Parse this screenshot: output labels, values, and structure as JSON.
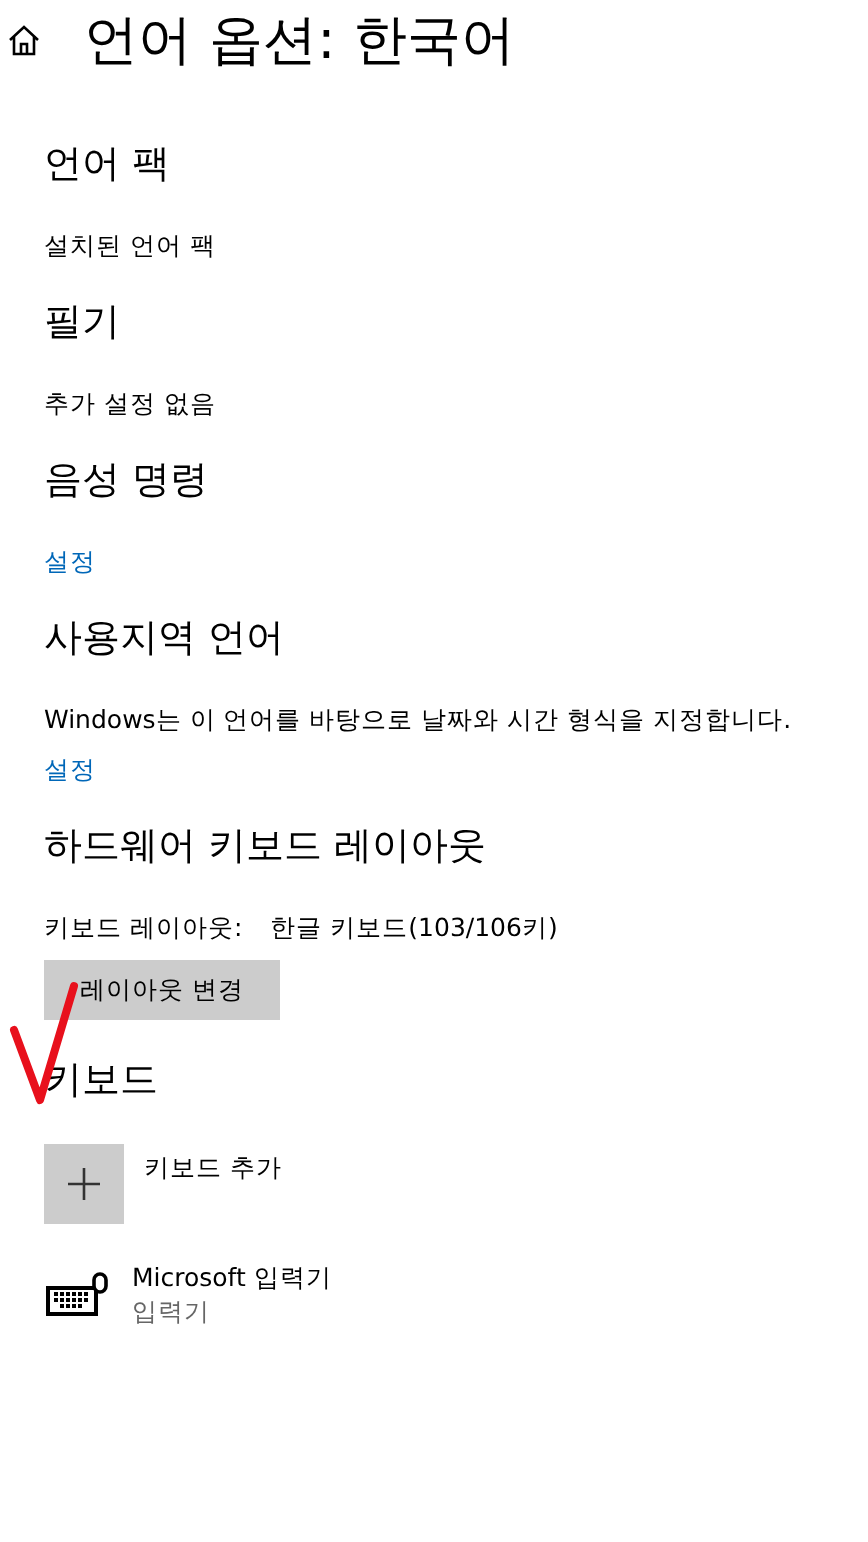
{
  "header": {
    "title": "언어 옵션: 한국어"
  },
  "sections": [
    {
      "heading": "언어 팩",
      "items": [
        {
          "kind": "text",
          "text": "설치된 언어 팩"
        }
      ]
    },
    {
      "heading": "필기",
      "items": [
        {
          "kind": "text",
          "text": "추가 설정 없음"
        }
      ]
    },
    {
      "heading": "음성 명령",
      "items": [
        {
          "kind": "link",
          "text": "설정"
        }
      ]
    },
    {
      "heading": "사용지역 언어",
      "items": [
        {
          "kind": "text",
          "text": "Windows는 이 언어를 바탕으로 날짜와 시간 형식을 지정합니다."
        },
        {
          "kind": "link",
          "text": "설정"
        }
      ]
    },
    {
      "heading": "하드웨어 키보드 레이아웃",
      "items": [
        {
          "kind": "pair",
          "label": "키보드 레이아웃:",
          "value": "한글 키보드(103/106키)"
        },
        {
          "kind": "button",
          "text": "레이아웃 변경"
        }
      ]
    },
    {
      "heading": "키보드",
      "items": [
        {
          "kind": "add",
          "text": "키보드 추가"
        },
        {
          "kind": "keyboard",
          "text": "Microsoft 입력기",
          "subtext": "입력기"
        }
      ]
    }
  ],
  "annotation": {
    "kind": "checkmark",
    "color": "#e8101c"
  }
}
